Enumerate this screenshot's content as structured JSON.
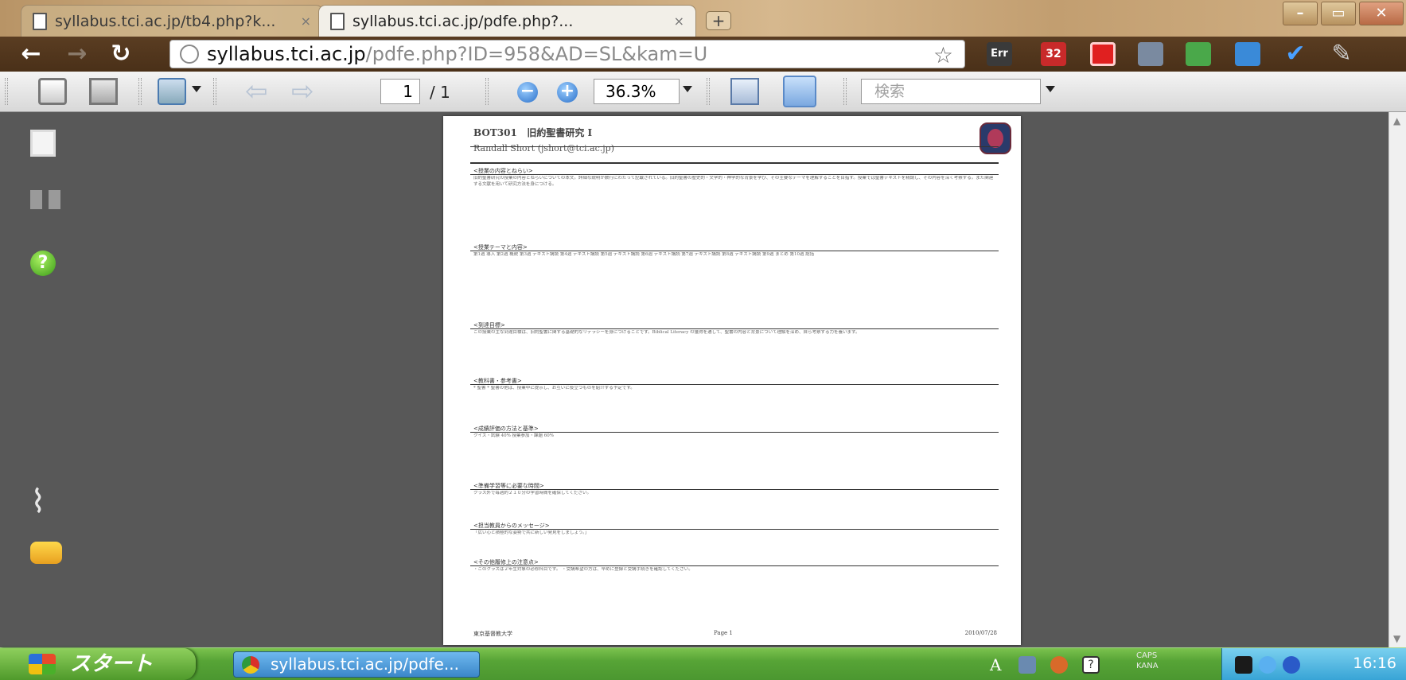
{
  "tabs": [
    {
      "title": "syllabus.tci.ac.jp/tb4.php?k...",
      "close": "×"
    },
    {
      "title": "syllabus.tci.ac.jp/pdfe.php?...",
      "close": "×"
    }
  ],
  "new_tab": "+",
  "window_controls": {
    "minimize": "–",
    "maximize": "▭",
    "close": "✕"
  },
  "address_bar": {
    "host": "syllabus.tci.ac.jp",
    "path": "/pdfe.php?ID=958&AD=SL&kam=U"
  },
  "extension_badges": {
    "err": "Err",
    "count": "32"
  },
  "pdf_toolbar": {
    "page_current": "1",
    "page_total": "/ 1",
    "zoom": "36.3%",
    "search_placeholder": "検索",
    "zoom_out": "−",
    "zoom_in": "+"
  },
  "pdf_page": {
    "course_code": "BOT301",
    "course_title": "旧約聖書研究 I",
    "author": "Randall Short (jshort@tci.ac.jp)",
    "sections": [
      {
        "heading": "<授業の内容とねらい>",
        "lines": "旧約聖書研究の授業の内容とねらいについての本文。詳細な説明が数行にわたって記載されている。旧約聖書の歴史的・文学的・神学的な背景を学び、その主要なテーマを理解することを目指す。授業では聖書テキストを精読し、その内容を深く考察する。また関連する文献を用いて研究方法を身につける。"
      },
      {
        "heading": "<授業テーマと内容>",
        "lines": "第1週 導入 第2週 概説 第3週 テキスト講読 第4週 テキスト講読 第5週 テキスト講読 第6週 テキスト講読 第7週 テキスト講読 第8週 テキスト講読 第9週 まとめ 第10週 総括"
      },
      {
        "heading": "<到達目標>",
        "lines": "この授業の主な到達目標は、旧約聖書に関する基礎的なリテラシーを身につけることです。Biblical Literacy の獲得を通して、聖書の内容と背景について理解を深め、自ら考察する力を養います。"
      },
      {
        "heading": "<教科書・参考書>",
        "lines": "* 聖書 * 聖書の他は、授業中に提示し、お互いに役立つものを紹介する予定です。"
      },
      {
        "heading": "<成績評価の方法と基準>",
        "lines": "クイズ・試験 40% 授業参加・課題 60%"
      },
      {
        "heading": "<準備学習等に必要な時間>",
        "lines": "クラス外で毎週約２１０分の学習時間を確保してください。"
      },
      {
        "heading": "<担当教員からのメッセージ>",
        "lines": "「広い心と積極的な姿勢で共に新しい発見をしましょう。」"
      },
      {
        "heading": "<その他履修上の注意点>",
        "lines": "・このクラスは２年生対象の必修科目です。 ・受講希望の方は、早めに登録と受講手続きを確認してください。"
      }
    ],
    "footer_left": "東京基督教大学",
    "footer_center": "Page 1",
    "footer_right": "2010/07/28"
  },
  "taskbar": {
    "start": "スタート",
    "task_item": "syllabus.tci.ac.jp/pdfe...",
    "caps": "CAPS",
    "kana": "KANA",
    "lang": "A",
    "clock": "16:16"
  }
}
